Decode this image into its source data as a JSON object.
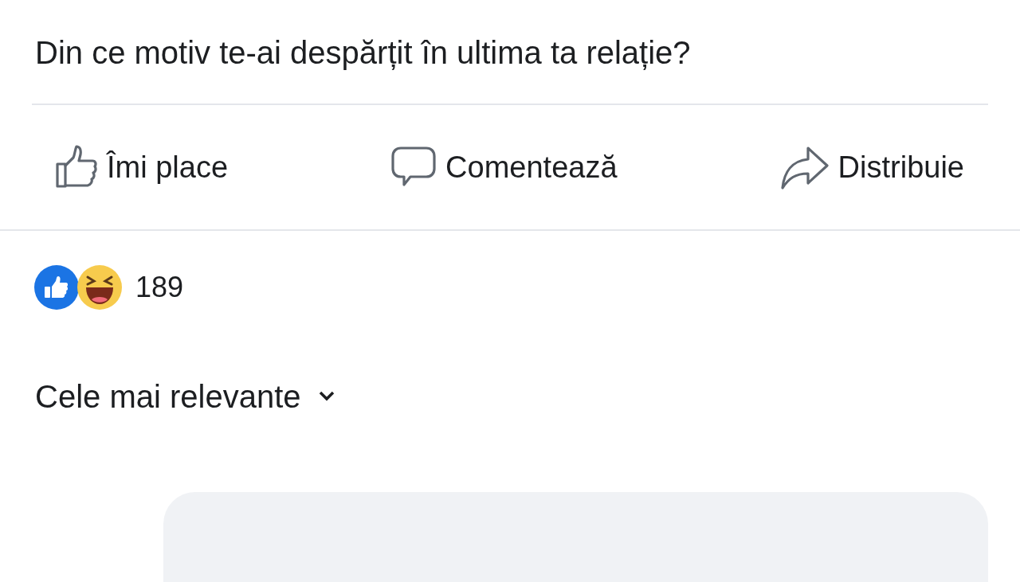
{
  "post": {
    "text": "Din ce motiv te-ai despărțit în ultima ta relație?"
  },
  "actions": [
    {
      "kind": "like",
      "label": "Îmi place"
    },
    {
      "kind": "comment",
      "label": "Comentează"
    },
    {
      "kind": "share",
      "label": "Distribuie"
    }
  ],
  "reactions": {
    "count": "189"
  },
  "comments_sort": {
    "label": "Cele mai relevante"
  }
}
